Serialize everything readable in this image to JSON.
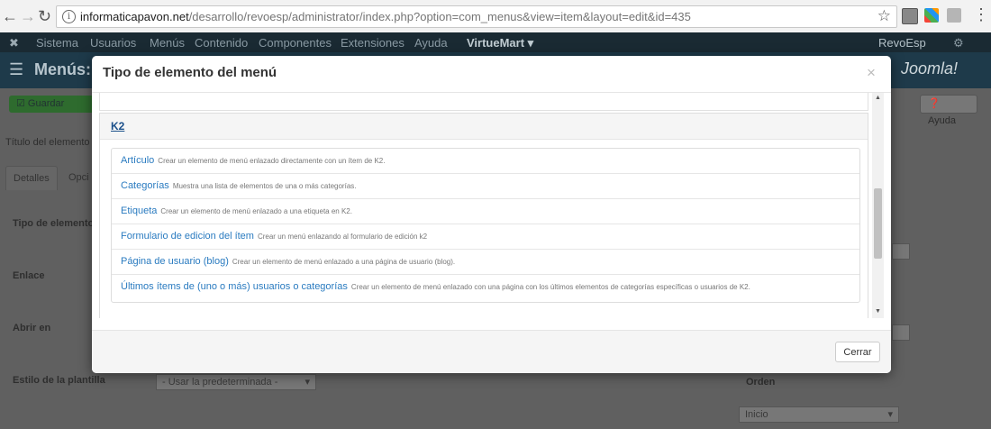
{
  "browser": {
    "url_host": "informaticapavon.net",
    "url_path": "/desarrollo/revoesp/administrator/index.php?option=com_menus&view=item&layout=edit&id=435"
  },
  "admin": {
    "nav": [
      "Sistema",
      "Usuarios",
      "Menús",
      "Contenido",
      "Componentes",
      "Extensiones",
      "Ayuda",
      "VirtueMart ▾"
    ],
    "site_name": "RevoEsp",
    "page_title": "Menús: E",
    "logo_text": "Joomla!",
    "save_label": "Guardar",
    "help_label": "Ayuda",
    "title_label": "Título del elemento",
    "tabs": [
      "Detalles",
      "Opci"
    ],
    "fields": [
      "Tipo de elemento",
      "Enlace",
      "Abrir en",
      "Estilo de la plantilla"
    ],
    "template_select": "- Usar la predeterminada -",
    "order_label": "Orden",
    "order_select": "Inicio"
  },
  "modal": {
    "title": "Tipo de elemento del menú",
    "close_symbol": "×",
    "section_title": "K2",
    "items": [
      {
        "name": "Artículo",
        "desc": "Crear un elemento de menú enlazado directamente con un ítem de K2."
      },
      {
        "name": "Categorías",
        "desc": "Muestra una lista de elementos de una o más categorías."
      },
      {
        "name": "Etiqueta",
        "desc": "Crear un elemento de menú enlazado a una etiqueta en K2."
      },
      {
        "name": "Formulario de edicion del ítem",
        "desc": "Crear un menú enlazando al formulario de edición k2"
      },
      {
        "name": "Página de usuario (blog)",
        "desc": "Crear un elemento de menú enlazado a una página de usuario (blog)."
      },
      {
        "name": "Últimos ítems de (uno o más) usuarios o categorías",
        "desc": "Crear un elemento de menú enlazado con una página con los últimos elementos de categorías específicas o usuarios de K2."
      }
    ],
    "close_button": "Cerrar"
  },
  "colors": {
    "link": "#2a7bc0",
    "section_link": "#1a4f8a",
    "admin_header": "#1e3a4a",
    "overlay": "#5b5b5b"
  }
}
